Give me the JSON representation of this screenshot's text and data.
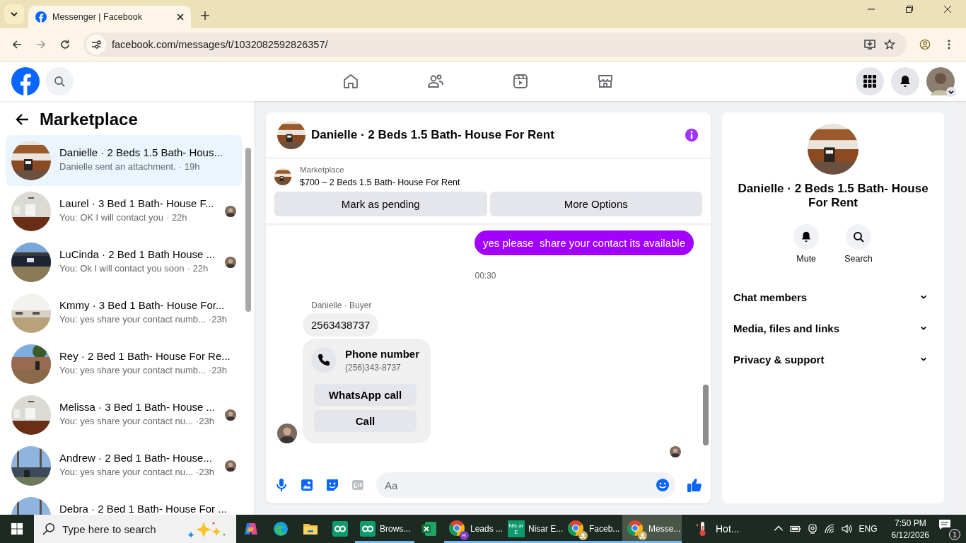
{
  "browser": {
    "tabs": [
      {
        "title": "Messenger | Facebook",
        "selected": true
      }
    ],
    "url": "facebook.com/messages/t/1032082592826357/"
  },
  "sidebar": {
    "title": "Marketplace",
    "conversations": [
      {
        "name": "Danielle · 2 Beds 1.5 Bath- Hous...",
        "preview": "Danielle sent an attachment.",
        "time": "· 19h",
        "selected": true,
        "seen": false
      },
      {
        "name": "Laurel · 3 Bed 1 Bath- House F...",
        "preview": "You: OK I will contact you",
        "time": "· 22h",
        "selected": false,
        "seen": true
      },
      {
        "name": "LuCinda · 2 Bed 1 Bath House ...",
        "preview": "You: Ok I will contact you soon",
        "time": "· 22h",
        "selected": false,
        "seen": true
      },
      {
        "name": "Kmmy · 3 Bed 1 Bath- House For...",
        "preview": "You: yes share your contact numb...",
        "time": "·23h",
        "selected": false,
        "seen": false
      },
      {
        "name": "Rey · 2 Bed 1 Bath- House For Re...",
        "preview": "You: yes share your contact numb...",
        "time": "·23h",
        "selected": false,
        "seen": false
      },
      {
        "name": "Melissa · 3 Bed 1 Bath- House ...",
        "preview": "You: yes share your contact nu...",
        "time": "·23h",
        "selected": false,
        "seen": true
      },
      {
        "name": "Andrew · 2 Bed 1 Bath- House...",
        "preview": "You: yes share your contact nu...",
        "time": "·23h",
        "selected": false,
        "seen": true
      },
      {
        "name": "Debra · 2 Bed 1 Bath- House For ...",
        "selected": false,
        "seen": false
      }
    ]
  },
  "chat": {
    "title": "Danielle · 2 Beds 1.5 Bath- House For Rent",
    "listing": {
      "source": "Marketplace",
      "summary": "$700 – 2 Beds 1.5 Bath- House For Rent"
    },
    "actions": [
      "Mark as pending",
      "More Options"
    ],
    "messages": [
      {
        "kind": "outgoing",
        "text": "yes please  share your contact its available"
      },
      {
        "kind": "timestamp",
        "text": "00:30"
      },
      {
        "kind": "incoming",
        "sender": "Danielle · Buyer",
        "text": "2563438737"
      },
      {
        "kind": "contact_card",
        "title": "Phone number",
        "number": "(256)343-8737",
        "buttons": [
          "WhatsApp call",
          "Call"
        ]
      }
    ],
    "composer": {
      "placeholder": "Aa"
    }
  },
  "details": {
    "name": "Danielle · 2 Beds 1.5 Bath- House For Rent",
    "actions": [
      {
        "kind": "mute",
        "label": "Mute"
      },
      {
        "kind": "search",
        "label": "Search"
      }
    ],
    "sections": [
      {
        "label": "Chat members",
        "expanded": false
      },
      {
        "label": "Media, files and links",
        "expanded": false
      },
      {
        "label": "Privacy & support",
        "expanded": false
      }
    ]
  },
  "taskbar": {
    "search_placeholder": "Type here to search",
    "apps": [
      {
        "kind": "copilot",
        "running": false,
        "active": false
      },
      {
        "kind": "edge",
        "running": false,
        "active": false
      },
      {
        "kind": "explorer",
        "running": false,
        "active": false
      },
      {
        "kind": "qo",
        "running": false,
        "active": false
      },
      {
        "kind": "qo",
        "label": "Brows...",
        "running": true,
        "active": false
      },
      {
        "kind": "excel",
        "running": false,
        "active": false
      },
      {
        "kind": "chrome",
        "badge": "R",
        "label": "Leads ...",
        "running": true,
        "active": false
      },
      {
        "kind": "tile",
        "icon_text": "Nis ar E",
        "label": "Nisar E...",
        "running": true,
        "active": false
      },
      {
        "kind": "chrome",
        "label": "Faceb...",
        "running": true,
        "active": false
      },
      {
        "kind": "chrome",
        "label": "Messe...",
        "running": true,
        "active": true
      }
    ],
    "weather": "Hot...",
    "language": "ENG",
    "time": "7:50 PM",
    "date": "6/12/2026",
    "notifications": "1"
  }
}
